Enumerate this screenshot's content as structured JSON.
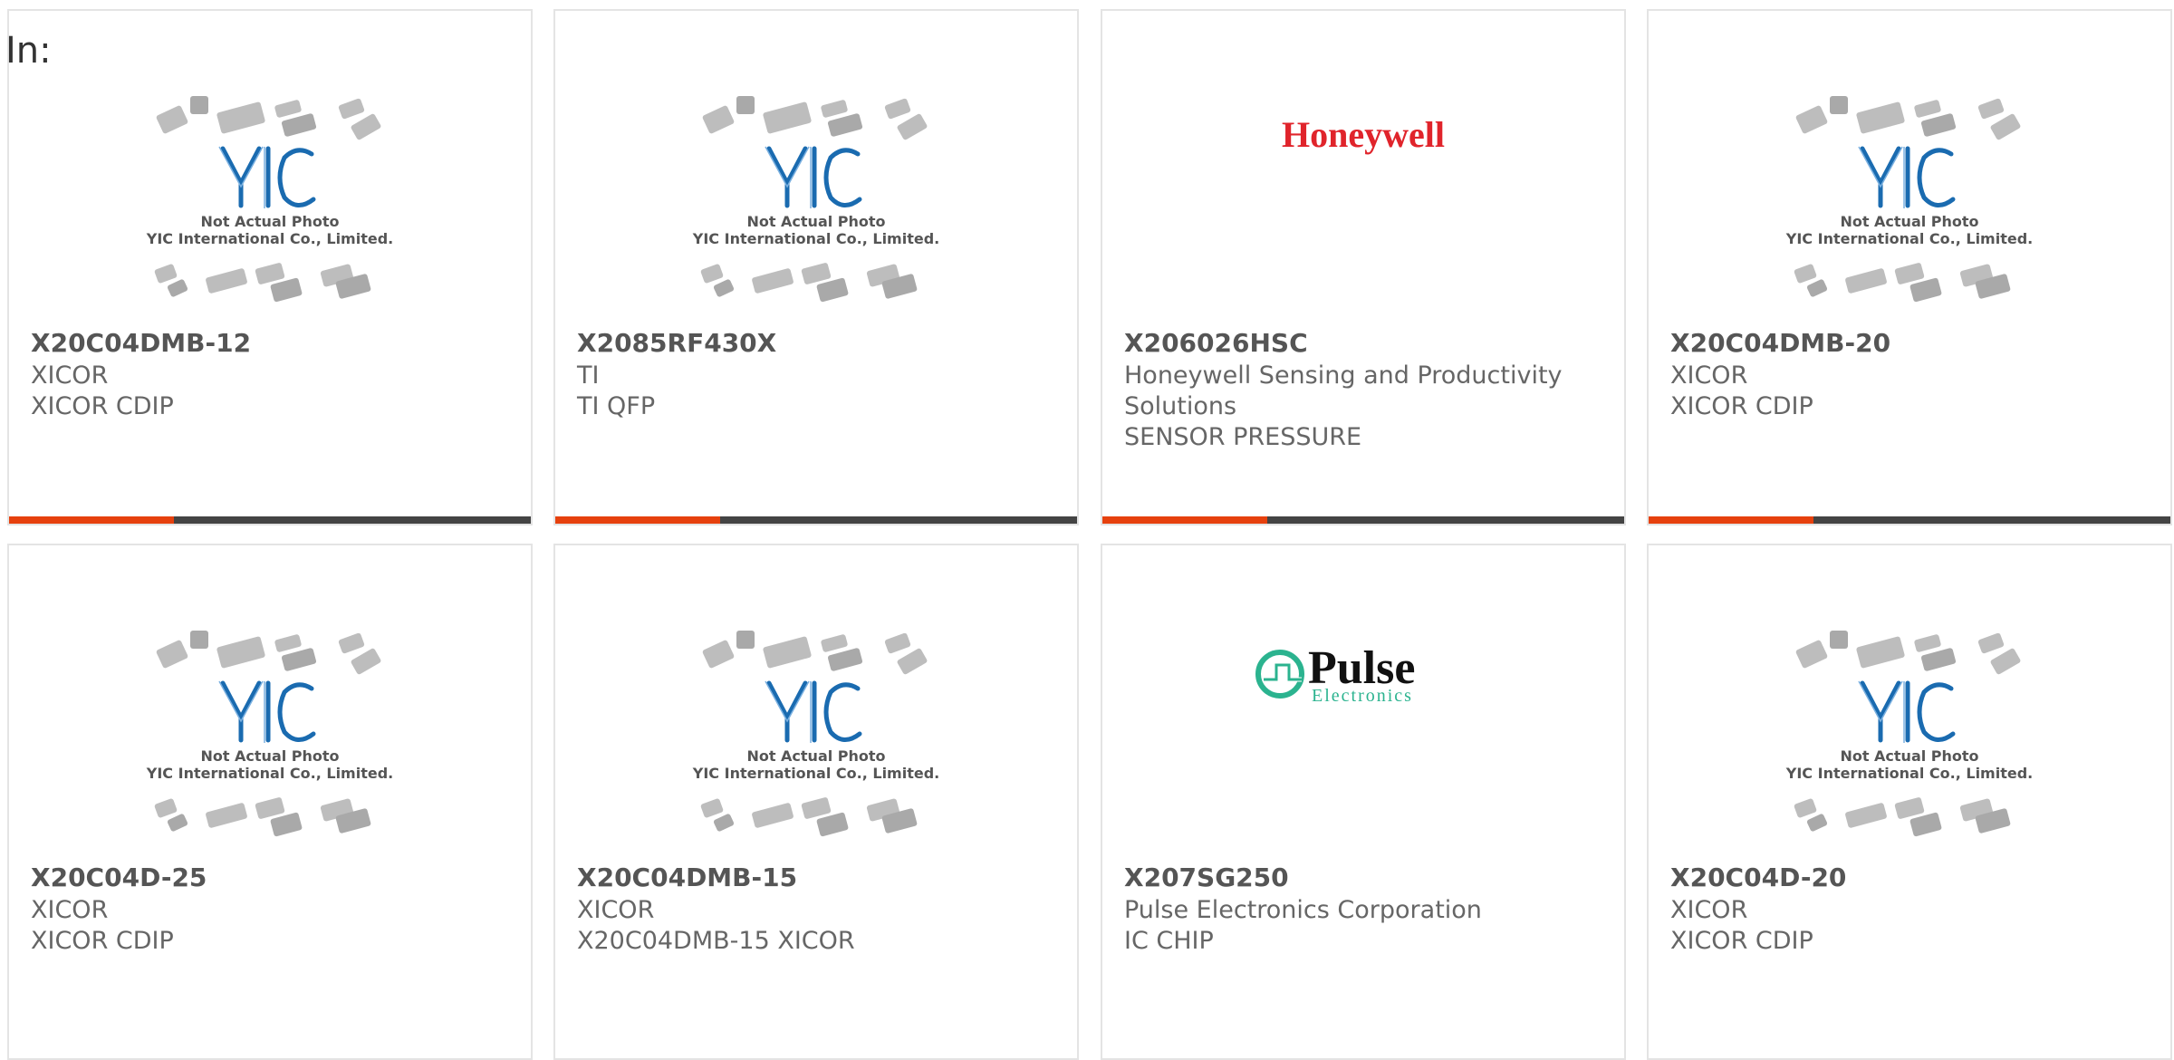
{
  "header": {
    "label": "In:"
  },
  "products": [
    {
      "part": "X20C04DMB-12",
      "manufacturer": "XICOR",
      "description": "XICOR CDIP",
      "image": "yic-placeholder"
    },
    {
      "part": "X2085RF430X",
      "manufacturer": "TI",
      "description": "TI QFP",
      "image": "yic-placeholder"
    },
    {
      "part": "X206026HSC",
      "manufacturer": "Honeywell Sensing and Productivity Solutions",
      "description": "SENSOR PRESSURE",
      "image": "honeywell-logo"
    },
    {
      "part": "X20C04DMB-20",
      "manufacturer": "XICOR",
      "description": "XICOR CDIP",
      "image": "yic-placeholder"
    },
    {
      "part": "X20C04D-25",
      "manufacturer": "XICOR",
      "description": "XICOR CDIP",
      "image": "yic-placeholder"
    },
    {
      "part": "X20C04DMB-15",
      "manufacturer": "XICOR",
      "description": "X20C04DMB-15 XICOR",
      "image": "yic-placeholder"
    },
    {
      "part": "X207SG250",
      "manufacturer": "Pulse Electronics Corporation",
      "description": "IC CHIP",
      "image": "pulse-logo"
    },
    {
      "part": "X20C04D-20",
      "manufacturer": "XICOR",
      "description": "XICOR CDIP",
      "image": "yic-placeholder"
    }
  ],
  "placeholder": {
    "line1": "Not Actual Photo",
    "line2": "YIC International Co., Limited."
  },
  "logos": {
    "honeywell": "Honeywell",
    "pulse_main": "Pulse",
    "pulse_sub": "Electronics"
  },
  "colors": {
    "accent": "#e6410e",
    "bar": "#444444",
    "honeywell_red": "#e0242b",
    "pulse_teal": "#2bb38f",
    "yic_blue": "#1a6bb0"
  }
}
